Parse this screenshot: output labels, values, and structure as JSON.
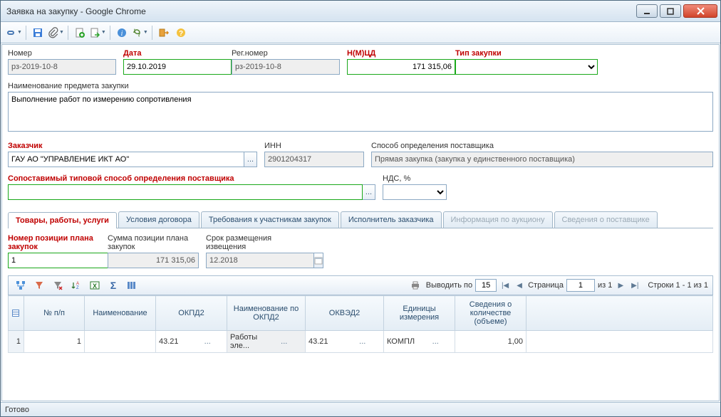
{
  "window": {
    "title": "Заявка на закупку - Google Chrome"
  },
  "header": {
    "row1": {
      "number_label": "Номер",
      "number": "рз-2019-10-8",
      "date_label": "Дата",
      "date": "29.10.2019",
      "regnum_label": "Рег.номер",
      "regnum": "рз-2019-10-8",
      "nmcd_label": "Н(М)ЦД",
      "nmcd": "171 315,06",
      "purchtype_label": "Тип закупки",
      "purchtype": ""
    },
    "subject_label": "Наименование предмета закупки",
    "subject": "Выполнение работ по измерению сопротивления",
    "customer_label": "Заказчик",
    "customer": "ГАУ АО \"УПРАВЛЕНИЕ ИКТ АО\"",
    "inn_label": "ИНН",
    "inn": "2901204317",
    "method_label": "Способ определения поставщика",
    "method": "Прямая закупка (закупка у единственного поставщика)",
    "compat_label": "Сопоставимый типовой способ определения поставщика",
    "compat": "",
    "vat_label": "НДС, %",
    "vat": ""
  },
  "tabs": [
    "Товары, работы, услуги",
    "Условия договора",
    "Требования к участникам закупок",
    "Исполнитель заказчика",
    "Информация по аукциону",
    "Сведения о поставщике"
  ],
  "tab1": {
    "posnum_label": "Номер позиции плана закупок",
    "posnum": "1",
    "plansum_label": "Сумма позиции плана закупок",
    "plansum": "171 315,06",
    "noticedate_label": "Срок размещения извещения",
    "noticedate": "12.2018",
    "paging": {
      "show_by_label": "Выводить по",
      "page_size": "15",
      "page_label": "Страница",
      "page": "1",
      "of_label": "из 1",
      "rows_label": "Строки 1 - 1 из 1"
    },
    "columns": [
      "",
      "№ п/п",
      "Наименование",
      "ОКПД2",
      "Наименование по ОКПД2",
      "ОКВЭД2",
      "Единицы измерения",
      "Сведения о количестве (объеме)"
    ],
    "rows": [
      {
        "rownum": "1",
        "npp": "1",
        "name": "",
        "okpd2": "43.21",
        "okpd2_name": "Работы эле...",
        "okved2": "43.21",
        "unit": "КОМПЛ",
        "qty": "1,00"
      }
    ]
  },
  "status": "Готово"
}
